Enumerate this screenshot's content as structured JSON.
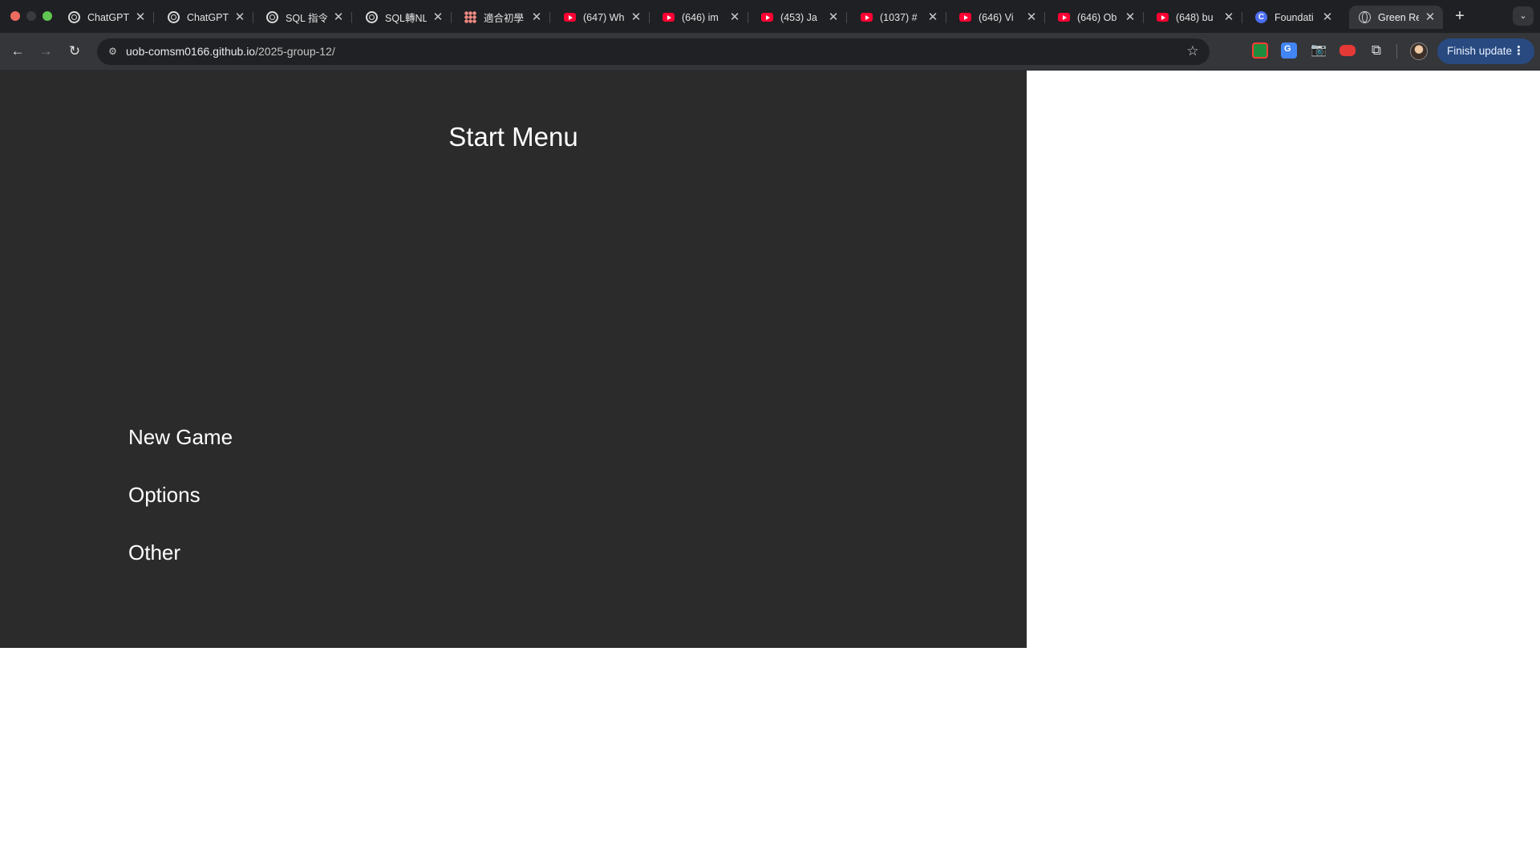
{
  "browser": {
    "tabs": [
      {
        "title": "ChatGPT",
        "icon": "chatgpt-icon"
      },
      {
        "title": "ChatGPT",
        "icon": "chatgpt-icon"
      },
      {
        "title": "SQL 指令",
        "icon": "chatgpt-icon"
      },
      {
        "title": "SQL轉NL",
        "icon": "chatgpt-icon"
      },
      {
        "title": "適合初學",
        "icon": "dots-icon"
      },
      {
        "title": "(647) Wh",
        "icon": "youtube-icon"
      },
      {
        "title": "(646) im",
        "icon": "youtube-icon"
      },
      {
        "title": "(453) Ja",
        "icon": "youtube-icon"
      },
      {
        "title": "(1037) #",
        "icon": "youtube-icon"
      },
      {
        "title": "(646) Vi",
        "icon": "youtube-icon"
      },
      {
        "title": "(646) Ob",
        "icon": "youtube-icon"
      },
      {
        "title": "(648) bu",
        "icon": "youtube-icon"
      },
      {
        "title": "Foundati",
        "icon": "c-icon"
      },
      {
        "title": "Green Re",
        "icon": "globe-icon",
        "active": true
      }
    ],
    "url_host": "uob-comsm0166.github.io",
    "url_path": "/2025-group-12/",
    "finish_update_label": "Finish update"
  },
  "game": {
    "title": "Start Menu",
    "menu": {
      "new_game": "New Game",
      "options": "Options",
      "other": "Other"
    },
    "background_color": "#2b2b2b",
    "text_color": "#ffffff"
  }
}
